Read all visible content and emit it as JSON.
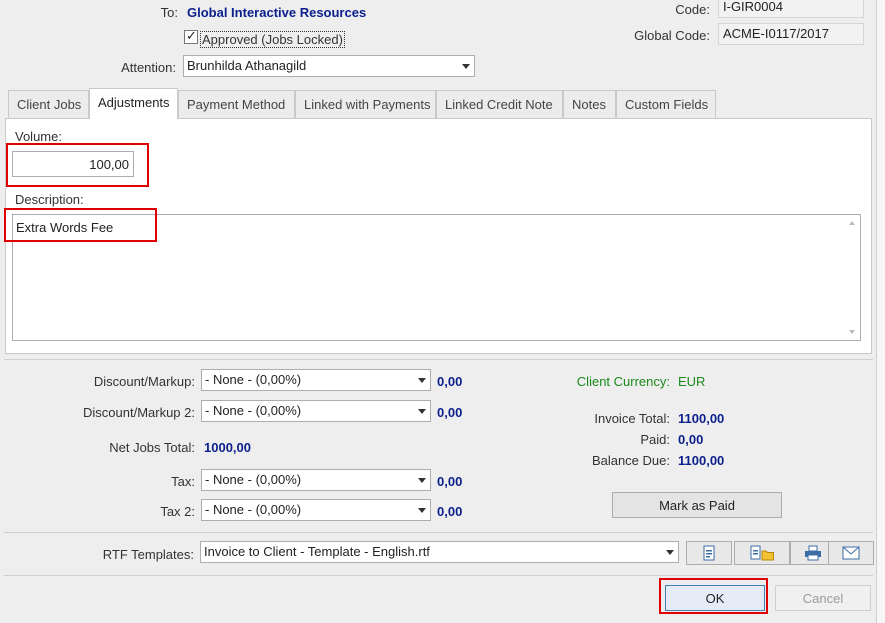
{
  "header": {
    "to_label": "To:",
    "to_value": "Global Interactive Resources",
    "approved_label": "Approved (Jobs Locked)",
    "approved_checked": true,
    "attention_label": "Attention:",
    "attention_value": "Brunhilda Athanagild",
    "code_label": "Code:",
    "code_value": "I-GIR0004",
    "global_code_label": "Global Code:",
    "global_code_value": "ACME-I0117/2017"
  },
  "tabs": [
    {
      "label": "Client Jobs",
      "active": false
    },
    {
      "label": "Adjustments",
      "active": true
    },
    {
      "label": "Payment Method",
      "active": false
    },
    {
      "label": "Linked with Payments",
      "active": false
    },
    {
      "label": "Linked Credit Note",
      "active": false
    },
    {
      "label": "Notes",
      "active": false
    },
    {
      "label": "Custom Fields",
      "active": false
    }
  ],
  "adjustments": {
    "volume_label": "Volume:",
    "volume_value": "100,00",
    "description_label": "Description:",
    "description_value": "Extra Words Fee"
  },
  "totals": {
    "discount_label": "Discount/Markup:",
    "discount_select": "- None - (0,00%)",
    "discount_value": "0,00",
    "discount2_label": "Discount/Markup 2:",
    "discount2_select": "- None - (0,00%)",
    "discount2_value": "0,00",
    "net_jobs_label": "Net Jobs Total:",
    "net_jobs_value": "1000,00",
    "tax_label": "Tax:",
    "tax_select": "- None - (0,00%)",
    "tax_value": "0,00",
    "tax2_label": "Tax 2:",
    "tax2_select": "- None - (0,00%)",
    "tax2_value": "0,00",
    "client_currency_label": "Client Currency:",
    "client_currency_value": "EUR",
    "invoice_total_label": "Invoice Total:",
    "invoice_total_value": "1100,00",
    "paid_label": "Paid:",
    "paid_value": "0,00",
    "balance_due_label": "Balance Due:",
    "balance_due_value": "1100,00",
    "mark_as_paid_label": "Mark as Paid"
  },
  "templates": {
    "label": "RTF Templates:",
    "value": "Invoice to Client - Template - English.rtf"
  },
  "footer": {
    "ok_label": "OK",
    "cancel_label": "Cancel"
  },
  "colors": {
    "accent_blue": "#0b1f8c",
    "currency_green": "#1a8a1a",
    "highlight_red": "#e00000"
  }
}
